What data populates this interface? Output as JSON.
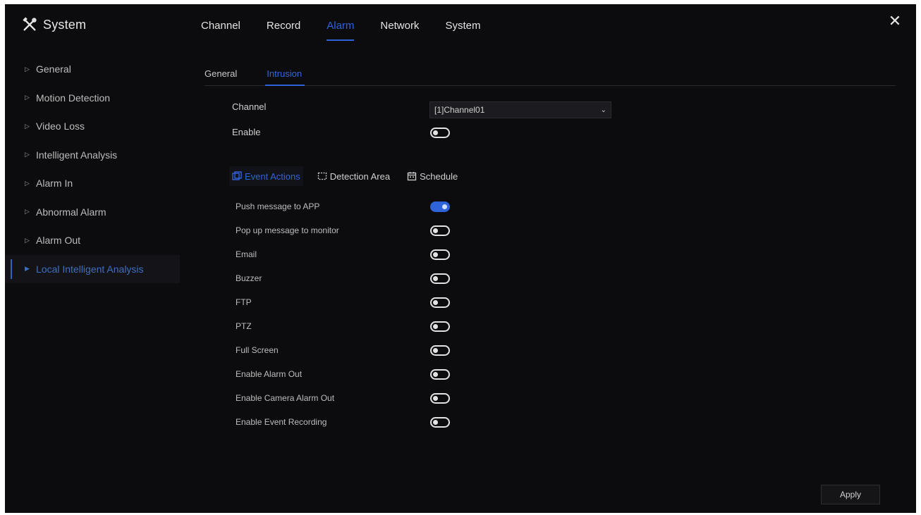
{
  "window": {
    "title": "System"
  },
  "topnav": {
    "tabs": [
      {
        "label": "Channel",
        "active": false
      },
      {
        "label": "Record",
        "active": false
      },
      {
        "label": "Alarm",
        "active": true
      },
      {
        "label": "Network",
        "active": false
      },
      {
        "label": "System",
        "active": false
      }
    ]
  },
  "sidebar": {
    "items": [
      {
        "label": "General",
        "active": false
      },
      {
        "label": "Motion Detection",
        "active": false
      },
      {
        "label": "Video Loss",
        "active": false
      },
      {
        "label": "Intelligent Analysis",
        "active": false
      },
      {
        "label": "Alarm In",
        "active": false
      },
      {
        "label": "Abnormal Alarm",
        "active": false
      },
      {
        "label": "Alarm Out",
        "active": false
      },
      {
        "label": "Local Intelligent Analysis",
        "active": true
      }
    ]
  },
  "subtabs": [
    {
      "label": "General",
      "active": false
    },
    {
      "label": "Intrusion",
      "active": true
    }
  ],
  "form": {
    "channel_label": "Channel",
    "channel_value": "[1]Channel01",
    "enable_label": "Enable",
    "enable_on": false
  },
  "section_tabs": [
    {
      "label": "Event Actions",
      "icon": "event-actions-icon",
      "active": true
    },
    {
      "label": "Detection Area",
      "icon": "detection-area-icon",
      "active": false
    },
    {
      "label": "Schedule",
      "icon": "calendar-icon",
      "active": false
    }
  ],
  "actions": [
    {
      "label": "Push message to APP",
      "on": true
    },
    {
      "label": "Pop up message to monitor",
      "on": false
    },
    {
      "label": "Email",
      "on": false
    },
    {
      "label": "Buzzer",
      "on": false
    },
    {
      "label": "FTP",
      "on": false
    },
    {
      "label": "PTZ",
      "on": false
    },
    {
      "label": "Full Screen",
      "on": false
    },
    {
      "label": "Enable Alarm Out",
      "on": false
    },
    {
      "label": "Enable Camera Alarm Out",
      "on": false
    },
    {
      "label": "Enable Event Recording",
      "on": false
    }
  ],
  "footer": {
    "apply_label": "Apply"
  },
  "colors": {
    "accent": "#2e63d9",
    "background": "#0c0c0e"
  }
}
